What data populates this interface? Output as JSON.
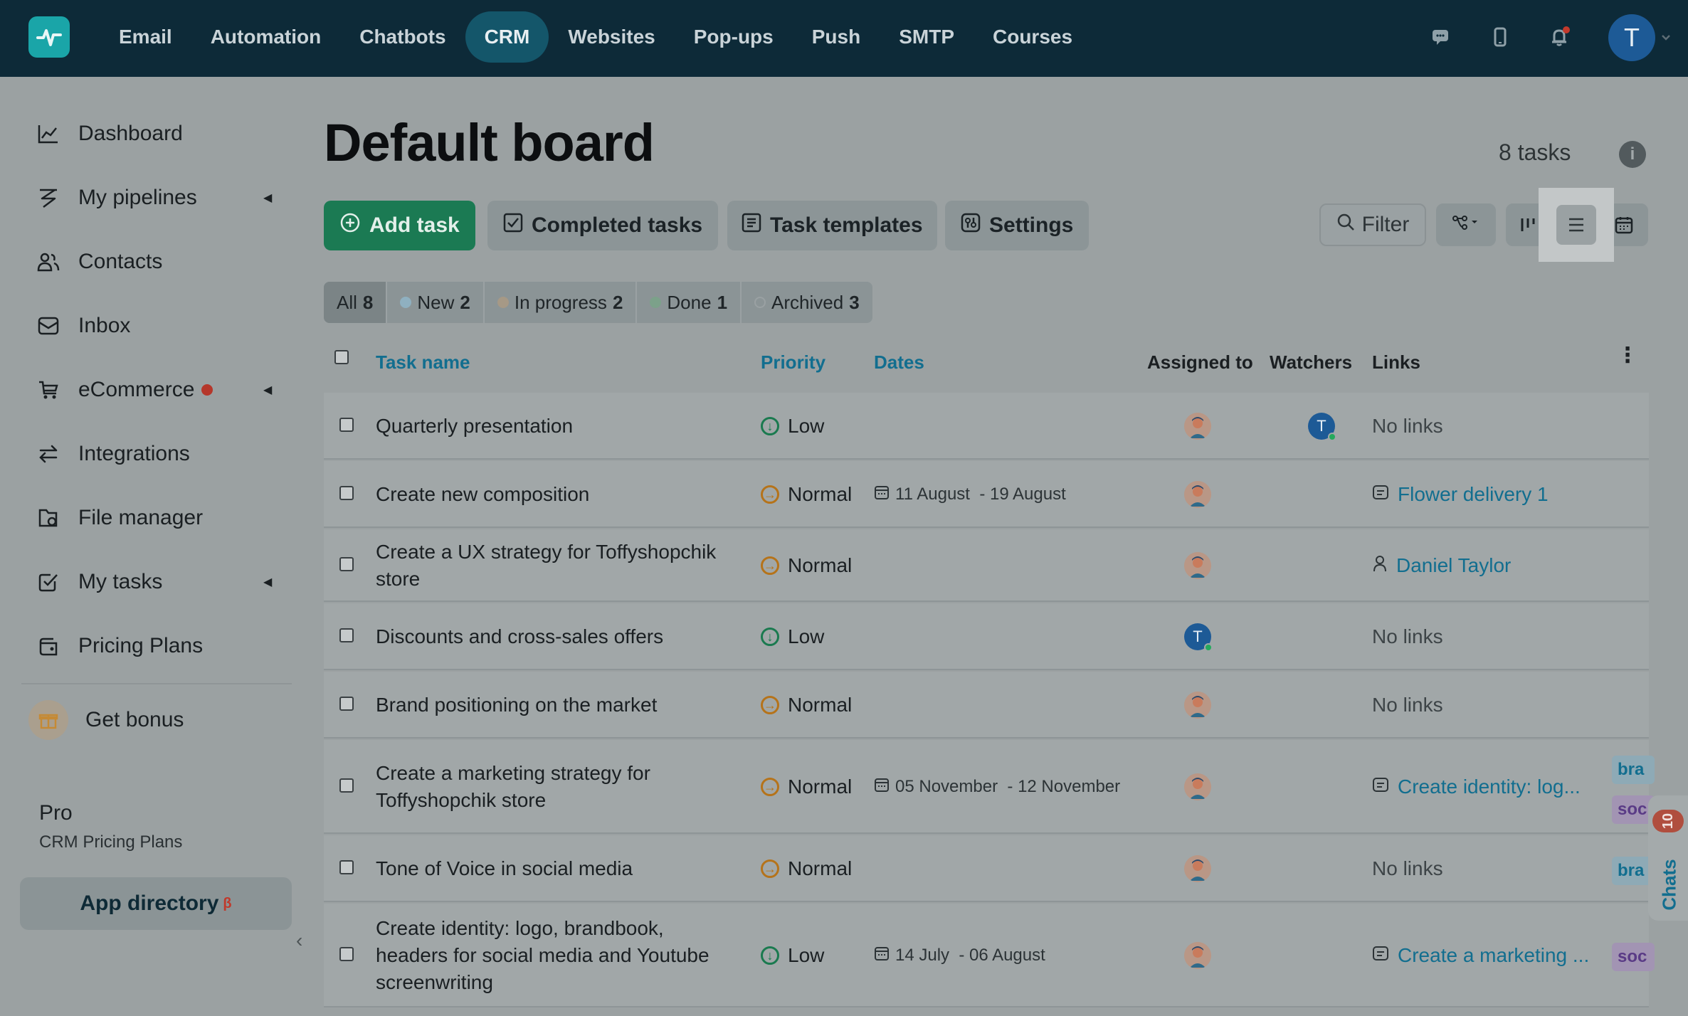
{
  "topbar": {
    "nav": [
      "Email",
      "Automation",
      "Chatbots",
      "CRM",
      "Websites",
      "Pop-ups",
      "Push",
      "SMTP",
      "Courses"
    ],
    "active": "CRM",
    "avatar_letter": "T"
  },
  "sidebar": {
    "items": [
      {
        "label": "Dashboard"
      },
      {
        "label": "My pipelines"
      },
      {
        "label": "Contacts"
      },
      {
        "label": "Inbox"
      },
      {
        "label": "eCommerce"
      },
      {
        "label": "Integrations"
      },
      {
        "label": "File manager"
      },
      {
        "label": "My tasks"
      },
      {
        "label": "Pricing Plans"
      }
    ],
    "bonus": "Get bonus",
    "plan": "Pro",
    "plan_sub": "CRM Pricing Plans",
    "app_directory": "App directory",
    "app_directory_sup": "β"
  },
  "header": {
    "title": "Default board",
    "count": "8 tasks"
  },
  "toolbar": {
    "add_task": "Add task",
    "completed": "Completed tasks",
    "templates": "Task templates",
    "settings": "Settings",
    "filter": "Filter"
  },
  "status_tabs": [
    {
      "label": "All",
      "count": "8"
    },
    {
      "label": "New",
      "count": "2"
    },
    {
      "label": "In progress",
      "count": "2"
    },
    {
      "label": "Done",
      "count": "1"
    },
    {
      "label": "Archived",
      "count": "3"
    }
  ],
  "table": {
    "headers": {
      "name": "Task name",
      "priority": "Priority",
      "dates": "Dates",
      "assigned": "Assigned to",
      "watchers": "Watchers",
      "links": "Links"
    },
    "rows": [
      {
        "name": "Quarterly presentation",
        "priority": "Low",
        "dates": "",
        "assigned": "avatar",
        "watcher": "T",
        "links": "No links"
      },
      {
        "name": "Create new composition",
        "priority": "Normal",
        "dates": "11 August  - 19 August",
        "assigned": "avatar",
        "watcher": "",
        "links": "Flower delivery 1"
      },
      {
        "name": "Create a UX strategy for Toffyshopchik store",
        "priority": "Normal",
        "dates": "",
        "assigned": "avatar",
        "watcher": "",
        "links": "Daniel Taylor"
      },
      {
        "name": "Discounts and cross-sales offers",
        "priority": "Low",
        "dates": "",
        "assigned": "T",
        "watcher": "",
        "links": "No links"
      },
      {
        "name": "Brand positioning on the market",
        "priority": "Normal",
        "dates": "",
        "assigned": "avatar",
        "watcher": "",
        "links": "No links"
      },
      {
        "name": "Create a marketing strategy for Toffyshopchik store",
        "priority": "Normal",
        "dates": "05 November  - 12 November",
        "assigned": "avatar",
        "watcher": "",
        "links": "Create identity: log..."
      },
      {
        "name": "Tone of Voice in social media",
        "priority": "Normal",
        "dates": "",
        "assigned": "avatar",
        "watcher": "",
        "links": "No links"
      },
      {
        "name": "Create identity: logo, brandbook, headers for social media and Youtube screenwriting",
        "priority": "Low",
        "dates": "14 July  - 06 August",
        "assigned": "avatar",
        "watcher": "",
        "links": "Create a marketing ..."
      }
    ],
    "tags": {
      "bra": "bra",
      "soc": "soc"
    }
  },
  "chats": {
    "label": "Chats",
    "count": "10"
  }
}
